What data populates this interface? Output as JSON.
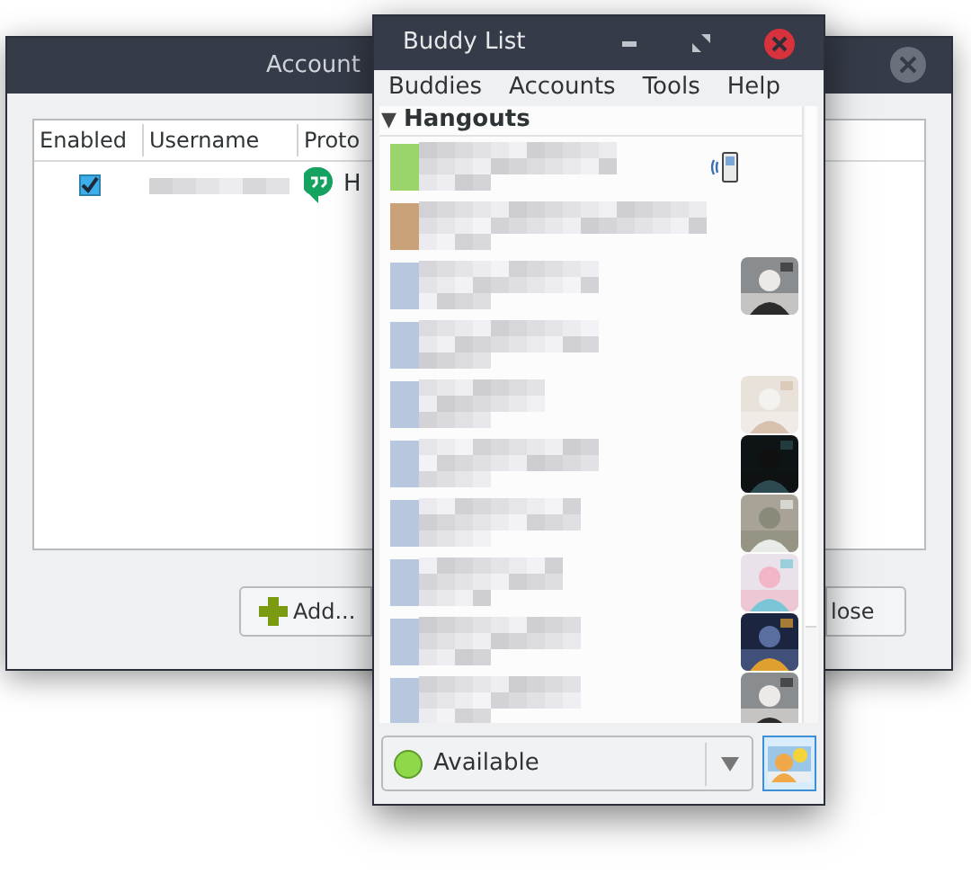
{
  "accounts_window": {
    "title": "Account",
    "columns": [
      "Enabled",
      "Username",
      "Proto"
    ],
    "rows": [
      {
        "enabled": true,
        "protocol": "H"
      }
    ],
    "buttons": [
      "Add...",
      "lose"
    ]
  },
  "buddy_window": {
    "title": "Buddy List",
    "menu": [
      "Buddies",
      "Accounts",
      "Tools",
      "Help"
    ],
    "group": {
      "label": "Hangouts",
      "expanded": true,
      "arrow": "▼"
    },
    "buddies": [
      {
        "kind": "mobile",
        "color": "#9bd46a"
      },
      {
        "kind": "plain",
        "color": "#c9a27a"
      },
      {
        "kind": "avatar",
        "color": "#b7c8de"
      },
      {
        "kind": "plain",
        "color": "#b7c8de"
      },
      {
        "kind": "avatar",
        "color": "#b7c8de"
      },
      {
        "kind": "avatar",
        "color": "#b7c8de"
      },
      {
        "kind": "avatar",
        "color": "#b7c8de"
      },
      {
        "kind": "avatar",
        "color": "#b7c8de"
      },
      {
        "kind": "avatar",
        "color": "#b7c8de"
      },
      {
        "kind": "avatar",
        "color": "#b7c8de"
      }
    ],
    "status": {
      "label": "Available"
    }
  }
}
